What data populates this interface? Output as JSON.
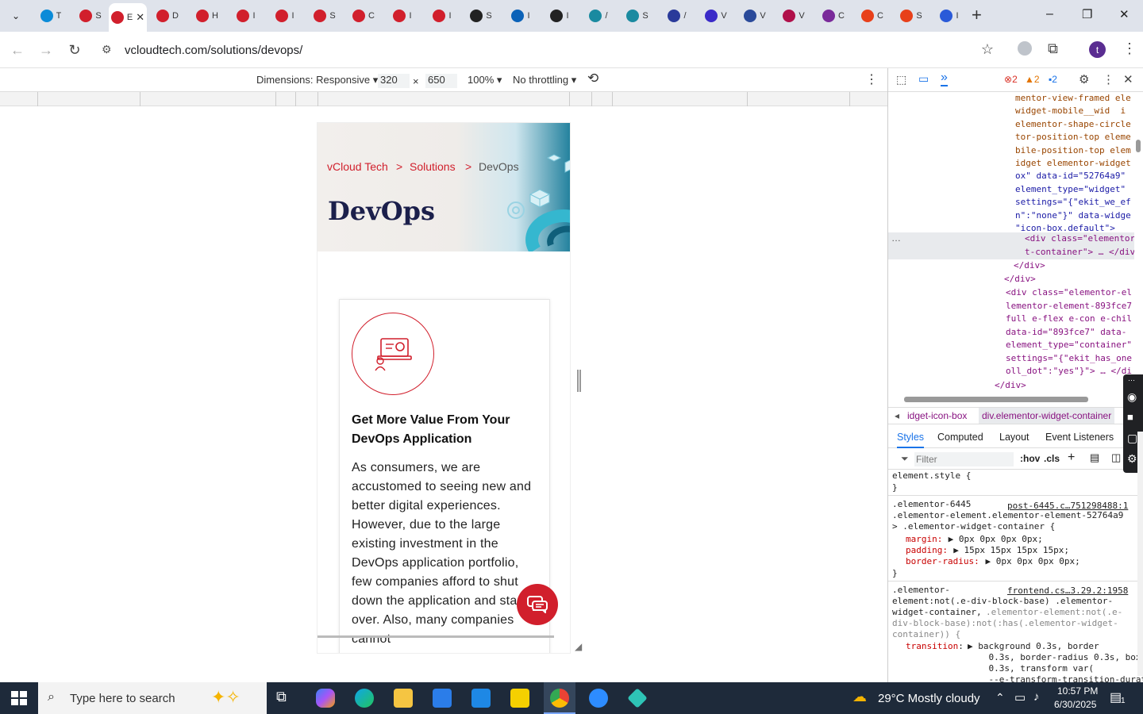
{
  "browser": {
    "tabs": [
      {
        "title": "T",
        "color": "#0b8bd8"
      },
      {
        "title": "S",
        "color": "#d11f2c"
      },
      {
        "title": "E",
        "color": "#d11f2c",
        "active": true
      },
      {
        "title": "D",
        "color": "#d11f2c"
      },
      {
        "title": "H",
        "color": "#d11f2c"
      },
      {
        "title": "I",
        "color": "#d11f2c"
      },
      {
        "title": "I",
        "color": "#d11f2c"
      },
      {
        "title": "S",
        "color": "#d11f2c"
      },
      {
        "title": "C",
        "color": "#d11f2c"
      },
      {
        "title": "I",
        "color": "#d11f2c"
      },
      {
        "title": "I",
        "color": "#d11f2c"
      },
      {
        "title": "S",
        "color": "#222222"
      },
      {
        "title": "I",
        "color": "#0b62b8"
      },
      {
        "title": "I",
        "color": "#222222"
      },
      {
        "title": "/",
        "color": "#1a8aa0"
      },
      {
        "title": "S",
        "color": "#1a8aa0"
      },
      {
        "title": "/",
        "color": "#2a3a9a"
      },
      {
        "title": "V",
        "color": "#3a2ac8"
      },
      {
        "title": "V",
        "color": "#2a4a9a"
      },
      {
        "title": "V",
        "color": "#b0104a"
      },
      {
        "title": "C",
        "color": "#7a2a9a"
      },
      {
        "title": "C",
        "color": "#e8401a"
      },
      {
        "title": "S",
        "color": "#e8401a"
      },
      {
        "title": "I",
        "color": "#2a5ad8"
      }
    ],
    "new_tab": "+",
    "minimize": "–",
    "maximize": "❐",
    "close": "✕",
    "url": "vcloudtech.com/solutions/devops/",
    "avatar_letter": "t"
  },
  "devbar": {
    "dimensions_label": "Dimensions: Responsive",
    "width": "320",
    "times": "×",
    "height": "650",
    "zoom": "100%",
    "throttle": "No throttling"
  },
  "site": {
    "breadcrumb": [
      "vCloud Tech",
      ">",
      "Solutions",
      ">",
      "DevOps"
    ],
    "hero_title": "DevOps",
    "card_title": "Get More Value From Your DevOps Application",
    "card_body": "As consumers, we are accustomed to seeing new and better digital experiences. However, due to the large existing investment in the DevOps application portfolio, few companies afford to shut down the application and start over. Also, many companies cannot"
  },
  "devtools": {
    "errors": "2",
    "warnings": "2",
    "infos": "2",
    "html_lines": [
      "mentor-view-framed ele",
      "widget-mobile__wid  i",
      "elementor-shape-circle",
      "tor-position-top eleme",
      "bile-position-top elem",
      "idget elementor-widget",
      "ox\" data-id=\"52764a9\"",
      "element_type=\"widget\"",
      "settings=\"{\"ekit_we_ef",
      "n\":\"none\"}\" data-widge",
      "\"icon-box.default\">"
    ],
    "selected_line_1": "<div class=\"elementor",
    "selected_line_2": "t-container\"> … </div",
    "close_div_1": "</div>",
    "close_div_2": "</div>",
    "next_div_lines": [
      "<div class=\"elementor-el",
      "lementor-element-893fce7",
      "full e-flex e-con e-chil",
      "data-id=\"893fce7\" data-",
      "element_type=\"container\"",
      "settings=\"{\"ekit_has_one",
      "oll_dot\":\"yes\"}\"> … </di"
    ],
    "close_div_3": "</div>",
    "crumb_1": "idget-icon-box",
    "crumb_2": "div.elementor-widget-container",
    "panel_tabs": [
      "Styles",
      "Computed",
      "Layout",
      "Event Listeners"
    ],
    "filter_placeholder": "Filter",
    "hov": ":hov",
    "cls": ".cls",
    "element_style": "element.style {",
    "close_brace": "}",
    "rule1_selector": ".elementor-6445\n.elementor-element.elementor-element-52764a9\n> .elementor-widget-container {",
    "rule1_source": "post-6445.c…751298488:1",
    "rule1_props": [
      {
        "name": "margin",
        "value": "▶ 0px 0px 0px 0px;"
      },
      {
        "name": "padding",
        "value": "▶ 15px 15px 15px 15px;"
      },
      {
        "name": "border-radius",
        "value": "▶ 0px 0px 0px 0px;"
      }
    ],
    "rule2_selector": ".elementor-\nelement:not(.e-div-block-base) .elementor-\nwidget-container,",
    "rule2_selector_dim": ".elementor-element:not(.e-\ndiv-block-base):not(:has(.elementor-widget-\ncontainer)) {",
    "rule2_source": "frontend.cs…3.29.2:1958",
    "rule2_prop": "transition",
    "rule2_value": "▶ background 0.3s, border\n    0.3s, border-radius 0.3s, box-shadow\n    0.3s, transform var(\n    --e-transform-transition-duration,"
  },
  "taskbar": {
    "search_placeholder": "Type here to search",
    "weather": "29°C  Mostly cloudy",
    "time": "10:57 PM",
    "date": "6/30/2025",
    "notif_count": "1"
  },
  "colors": {
    "brand_red": "#d11f2c",
    "navy": "#1b1f4b",
    "devtools_blue": "#1a73e8"
  }
}
